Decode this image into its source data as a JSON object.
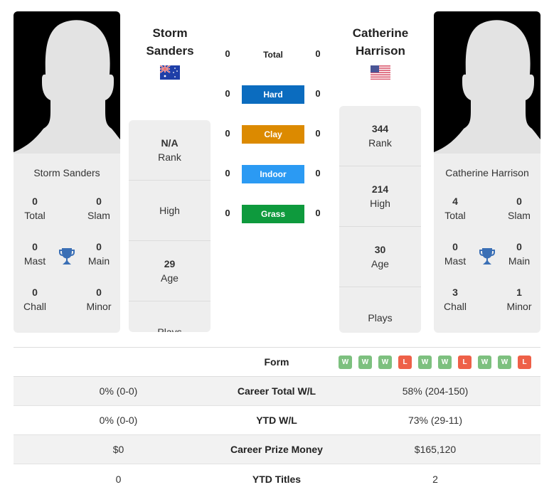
{
  "player1": {
    "name_line1": "Storm",
    "name_line2": "Sanders",
    "photo_caption": "Storm Sanders",
    "flag": "australia-flag",
    "titles": {
      "total": "0",
      "total_label": "Total",
      "slam": "0",
      "slam_label": "Slam",
      "mast": "0",
      "mast_label": "Mast",
      "main": "0",
      "main_label": "Main",
      "chall": "0",
      "chall_label": "Chall",
      "minor": "0",
      "minor_label": "Minor"
    },
    "info": {
      "rank": "N/A",
      "rank_label": "Rank",
      "high": "",
      "high_label": "High",
      "age": "29",
      "age_label": "Age",
      "plays": "",
      "plays_label": "Plays"
    }
  },
  "player2": {
    "name_line1": "Catherine",
    "name_line2": "Harrison",
    "photo_caption": "Catherine Harrison",
    "flag": "usa-flag",
    "titles": {
      "total": "4",
      "total_label": "Total",
      "slam": "0",
      "slam_label": "Slam",
      "mast": "0",
      "mast_label": "Mast",
      "main": "0",
      "main_label": "Main",
      "chall": "3",
      "chall_label": "Chall",
      "minor": "1",
      "minor_label": "Minor"
    },
    "info": {
      "rank": "344",
      "rank_label": "Rank",
      "high": "214",
      "high_label": "High",
      "age": "30",
      "age_label": "Age",
      "plays": "",
      "plays_label": "Plays"
    }
  },
  "surfaces": [
    {
      "label": "Total",
      "p1": "0",
      "p2": "0",
      "color": "transparent"
    },
    {
      "label": "Hard",
      "p1": "0",
      "p2": "0",
      "color": "#0b6cbf"
    },
    {
      "label": "Clay",
      "p1": "0",
      "p2": "0",
      "color": "#dc8a00"
    },
    {
      "label": "Indoor",
      "p1": "0",
      "p2": "0",
      "color": "#2b9af3"
    },
    {
      "label": "Grass",
      "p1": "0",
      "p2": "0",
      "color": "#0e9a3d"
    }
  ],
  "form": {
    "label": "Form",
    "results": [
      "W",
      "W",
      "W",
      "L",
      "W",
      "W",
      "L",
      "W",
      "W",
      "L"
    ],
    "colors": {
      "W": "#7dc07f",
      "L": "#ee6048"
    }
  },
  "stats": [
    {
      "p1": "0% (0-0)",
      "label": "Career Total W/L",
      "p2": "58% (204-150)"
    },
    {
      "p1": "0% (0-0)",
      "label": "YTD W/L",
      "p2": "73% (29-11)"
    },
    {
      "p1": "$0",
      "label": "Career Prize Money",
      "p2": "$165,120"
    },
    {
      "p1": "0",
      "label": "YTD Titles",
      "p2": "2"
    }
  ],
  "colors": {
    "trophy": "#3a6fb5",
    "card_bg": "#eeeeee"
  }
}
